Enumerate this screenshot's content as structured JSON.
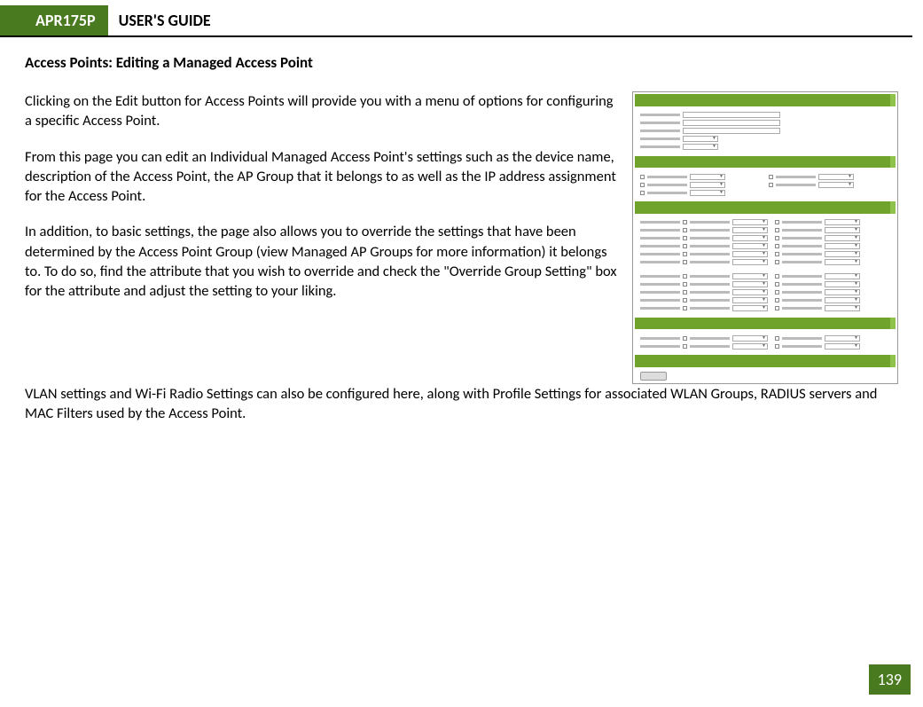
{
  "header": {
    "badge": "APR175P",
    "title": "USER'S GUIDE"
  },
  "section_title": "Access Points: Editing a Managed Access Point",
  "paragraphs": {
    "p1": "Clicking on the Edit button for Access Points will provide you with a menu of options for configuring a specific Access Point.",
    "p2": "From this page you can edit an Individual Managed Access Point's settings such as the device name, description of the Access Point, the AP Group that it belongs to as well as the IP address assignment for the Access Point.",
    "p3": "In addition, to basic settings, the page also allows you to override the settings that have been determined by the Access Point Group (view Managed AP Groups for more information) it belongs to.  To do so, find the attribute that you wish to override and check the \"Override Group Setting\" box for the attribute and adjust the setting to your liking.",
    "p4": "VLAN settings and Wi-Fi Radio Settings can also be configured here, along with Profile Settings for associated WLAN Groups, RADIUS servers and MAC Filters used by the Access Point."
  },
  "page_number": "139"
}
